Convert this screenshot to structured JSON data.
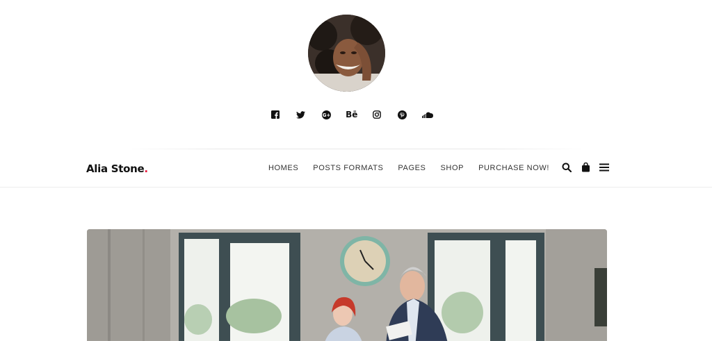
{
  "profile": {
    "avatar_icon": "portrait-photo"
  },
  "social": [
    {
      "name": "facebook-icon"
    },
    {
      "name": "twitter-icon"
    },
    {
      "name": "google-plus-icon"
    },
    {
      "name": "behance-icon",
      "glyph": "Bē"
    },
    {
      "name": "instagram-icon"
    },
    {
      "name": "pinterest-icon"
    },
    {
      "name": "soundcloud-icon"
    }
  ],
  "header": {
    "logo": "Alia Stone",
    "logo_dot": ".",
    "accent_color": "#e8173a",
    "menu": [
      "HOMES",
      "POSTS FORMATS",
      "PAGES",
      "SHOP",
      "PURCHASE NOW!"
    ],
    "tools": [
      "search-icon",
      "shopping-bag-icon",
      "hamburger-menu-icon"
    ]
  },
  "hero": {
    "image_icon": "office-meeting-photo"
  }
}
